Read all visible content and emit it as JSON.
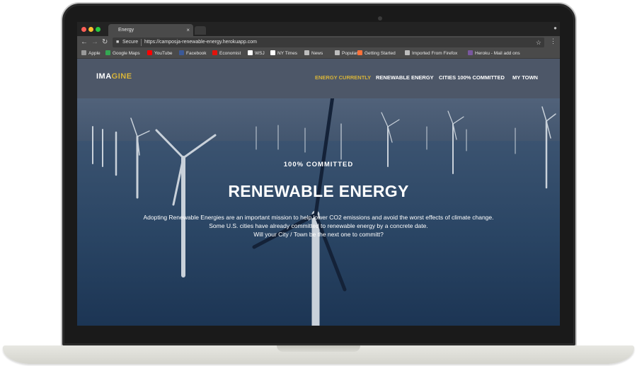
{
  "browser": {
    "tab_title": "Energy",
    "tab_close": "×",
    "secure_label": "Secure",
    "url": "https://camposja-renewable-energy.herokuapp.com",
    "bookmarks": [
      {
        "label": "Apple",
        "color": "#9a9a9a"
      },
      {
        "label": "Google Maps",
        "color": "#34a853"
      },
      {
        "label": "YouTube",
        "color": "#ff0000"
      },
      {
        "label": "Facebook",
        "color": "#3b5998"
      },
      {
        "label": "Economist",
        "color": "#e3120b"
      },
      {
        "label": "WSJ",
        "color": "#ffffff"
      },
      {
        "label": "NY Times",
        "color": "#ffffff"
      },
      {
        "label": "News",
        "color": "#bdbdbd"
      },
      {
        "label": "Popular",
        "color": "#bdbdbd"
      },
      {
        "label": "Getting Started",
        "color": "#ff7139"
      },
      {
        "label": "Imported From Firefox",
        "color": "#bdbdbd"
      },
      {
        "label": "Heroku - Mail add ons",
        "color": "#79589f"
      }
    ]
  },
  "site": {
    "logo_main": "IMA",
    "logo_accent": "GINE",
    "accent_color": "#d8b439",
    "nav": [
      {
        "label": "ENERGY CURRENTLY",
        "active": true
      },
      {
        "label": "RENEWABLE ENERGY",
        "active": false
      },
      {
        "label": "CITIES 100% COMMITTED",
        "active": false
      },
      {
        "label": "MY TOWN",
        "active": false
      }
    ]
  },
  "hero": {
    "kicker": "100% COMMITTED",
    "title": "RENEWABLE ENERGY",
    "description_lines": [
      "Adopting Renewable Energies are an important mission to help lower CO2 emissions and avoid the worst effects of climate change.",
      "Some U.S. cities have already committed to renewable energy by a concrete date.",
      "Will your City / Town be the next one to committ?"
    ]
  }
}
